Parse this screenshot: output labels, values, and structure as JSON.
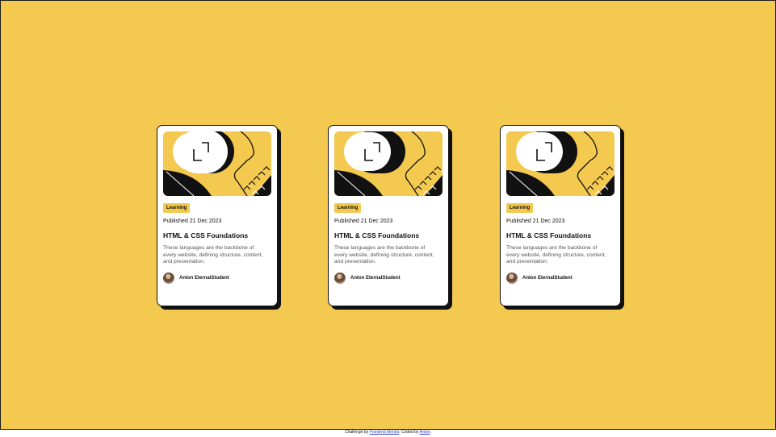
{
  "cards": [
    {
      "tag": "Learning",
      "published": "Published 21 Dec 2023",
      "title": "HTML & CSS Foundations",
      "description": "These languages are the backbone of every website, defining structure, content, and presentation.",
      "author": "Anton EternalStudent"
    },
    {
      "tag": "Learning",
      "published": "Published 21 Dec 2023",
      "title": "HTML & CSS Foundations",
      "description": "These languages are the backbone of every website, defining structure, content, and presentation.",
      "author": "Anton EternalStudent"
    },
    {
      "tag": "Learning",
      "published": "Published 21 Dec 2023",
      "title": "HTML & CSS Foundations",
      "description": "These languages are the backbone of every website, defining structure, content, and presentation.",
      "author": "Anton EternalStudent"
    }
  ],
  "footer": {
    "prefix": "Challenge by",
    "challenge_link": "Frontend Mentor",
    "middle": ". Coded by",
    "author_link": "Anton",
    "suffix": "."
  },
  "colors": {
    "background": "#f4c94f",
    "card": "#ffffff",
    "ink": "#111111",
    "link": "#2a3fd6"
  }
}
